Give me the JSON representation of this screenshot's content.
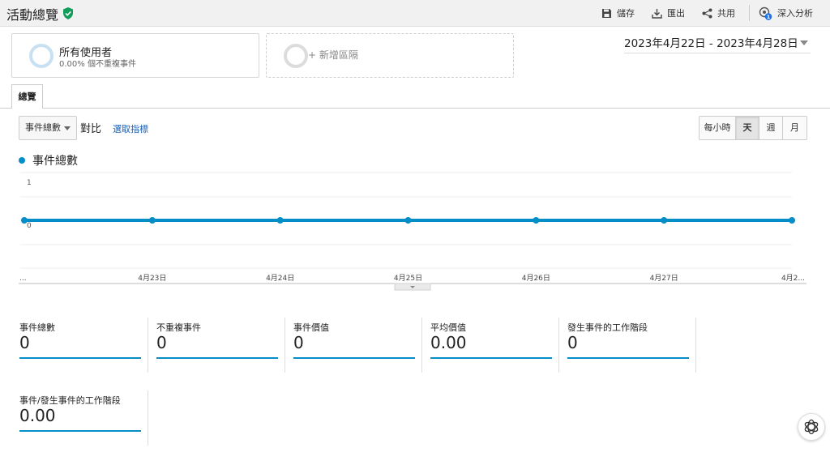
{
  "header": {
    "title": "活動總覽",
    "save_label": "儲存",
    "export_label": "匯出",
    "share_label": "共用",
    "insights_label": "深入分析",
    "insights_badge": "1"
  },
  "segments": {
    "all_users": {
      "name": "所有使用者",
      "sub": "0.00% 個不重複事件"
    },
    "add_segment": "+ 新增區隔"
  },
  "date_range": "2023年4月22日 - 2023年4月28日",
  "tabs": {
    "overview": "總覽"
  },
  "controls": {
    "metric_select": "事件總數",
    "vs_label": "對比",
    "pick_metric_link": "選取指標",
    "granularity": [
      {
        "label": "每小時",
        "active": false
      },
      {
        "label": "天",
        "active": true
      },
      {
        "label": "週",
        "active": false
      },
      {
        "label": "月",
        "active": false
      }
    ]
  },
  "legend_label": "事件總數",
  "chart_data": {
    "type": "line",
    "series": [
      {
        "name": "事件總數",
        "color": "#058dc7",
        "values": [
          0,
          0,
          0,
          0,
          0,
          0,
          0
        ]
      }
    ],
    "x_tick_labels": [
      "...",
      "4月23日",
      "4月24日",
      "4月25日",
      "4月26日",
      "4月27日",
      "4月2..."
    ],
    "y_tick_labels": [
      "1",
      "0"
    ],
    "ylim": [
      0,
      1
    ],
    "grid": true
  },
  "metrics": [
    {
      "label": "事件總數",
      "value": "0"
    },
    {
      "label": "不重複事件",
      "value": "0"
    },
    {
      "label": "事件價值",
      "value": "0"
    },
    {
      "label": "平均價值",
      "value": "0.00"
    },
    {
      "label": "發生事件的工作階段",
      "value": "0"
    }
  ],
  "metrics_row2": [
    {
      "label": "事件/發生事件的工作階段",
      "value": "0.00"
    }
  ],
  "colors": {
    "accent": "#058dc7",
    "link": "#1a5fb4",
    "verified": "#0f9d58"
  },
  "icons": [
    "verified-shield-icon",
    "save-icon",
    "export-icon",
    "share-icon",
    "insights-icon",
    "ai-assistant-icon"
  ]
}
